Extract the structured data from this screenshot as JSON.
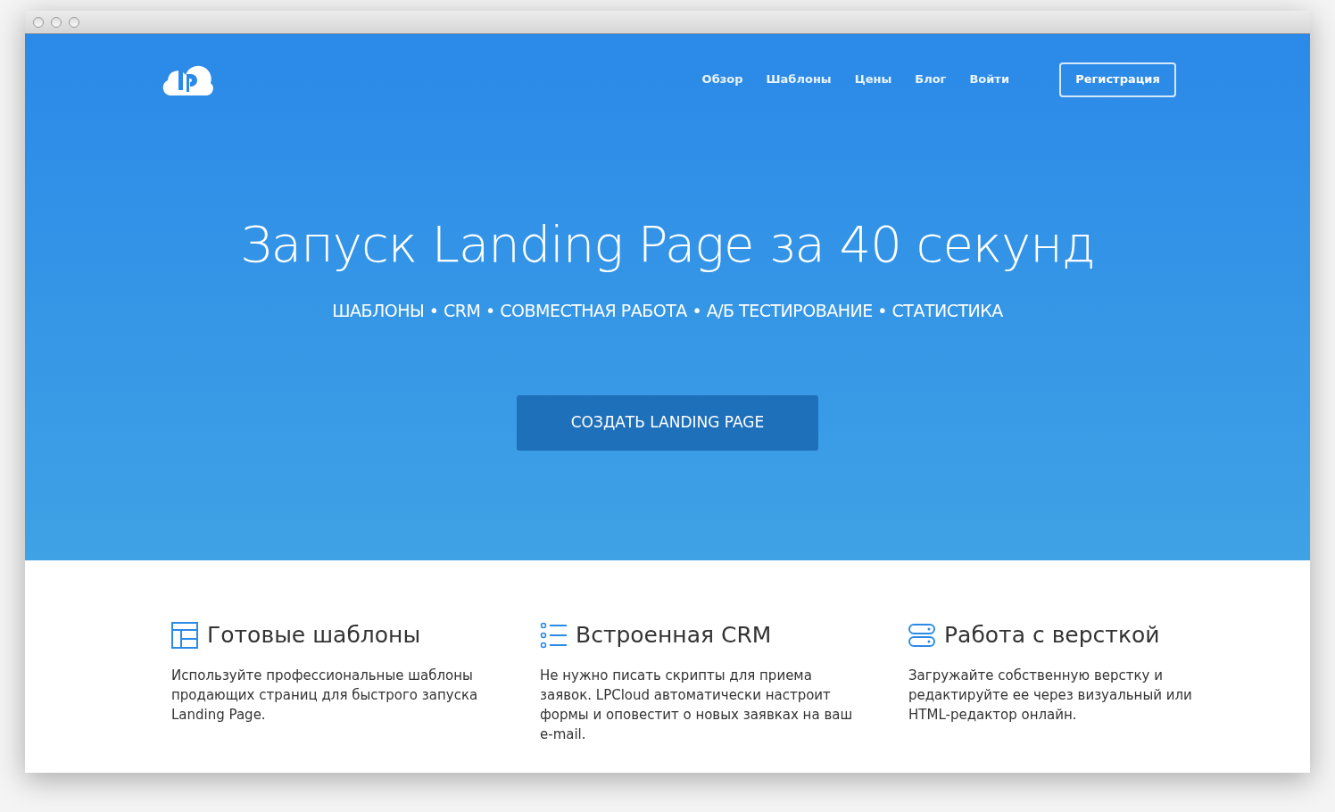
{
  "nav": {
    "links": [
      "Обзор",
      "Шаблоны",
      "Цены",
      "Блог",
      "Войти"
    ],
    "register": "Регистрация"
  },
  "hero": {
    "title": "Запуск Landing Page за 40 секунд",
    "subtitle": "ШАБЛОНЫ • CRM • СОВМЕСТНАЯ РАБОТА • А/Б ТЕСТИРОВАНИЕ • СТАТИСТИКА",
    "cta": "СОЗДАТЬ LANDING PAGE"
  },
  "features": [
    {
      "kind": "grid",
      "title": "Готовые шаблоны",
      "text": "Используйте профессиональные шаблоны продающих страниц для быстрого запуска Landing Page."
    },
    {
      "kind": "list",
      "title": "Встроенная CRM",
      "text": "Не нужно писать скрипты для приема заявок. LPCloud автоматически настроит формы и оповестит о новых заявках на ваш e-mail."
    },
    {
      "kind": "server",
      "title": "Работа с версткой",
      "text": "Загружайте собственную верстку и редактируйте ее через визуальный или HTML-редактор онлайн."
    }
  ]
}
